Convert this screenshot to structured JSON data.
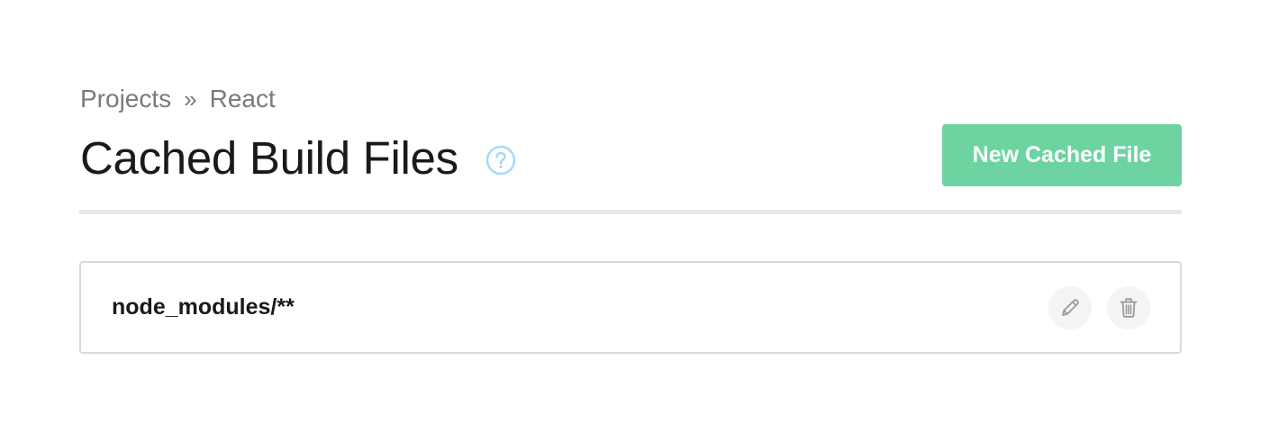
{
  "breadcrumb": {
    "items": [
      "Projects",
      "React"
    ],
    "separator": "»"
  },
  "header": {
    "title": "Cached Build Files",
    "help_icon": "question-circle-icon",
    "new_button_label": "New Cached File"
  },
  "files": [
    {
      "name": "node_modules/**",
      "actions": [
        "pencil-icon",
        "trash-icon"
      ]
    }
  ],
  "colors": {
    "accent_green": "#6dd4a1",
    "help_blue": "#a9d8f5",
    "breadcrumb_gray": "#7a7a7a",
    "title_dark": "#1a1a1a"
  }
}
